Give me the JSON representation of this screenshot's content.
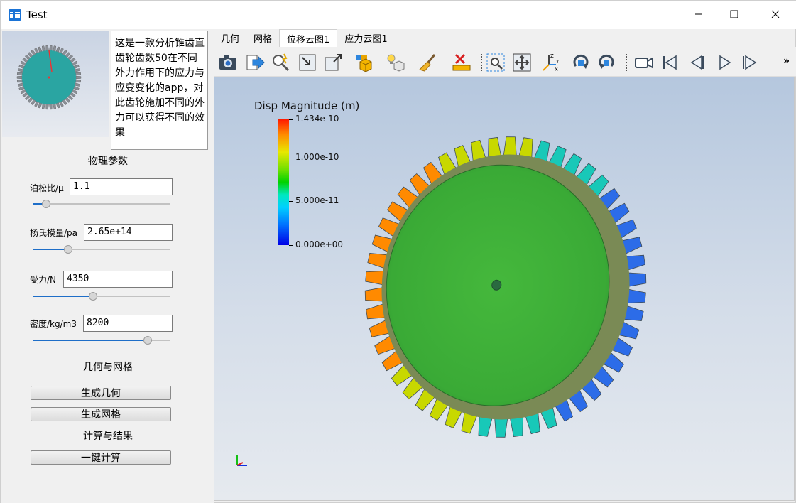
{
  "window": {
    "title": "Test",
    "icon": "app-table-icon",
    "controls": [
      "minimize-icon",
      "maximize-icon",
      "close-icon"
    ]
  },
  "left": {
    "description": "这是一款分析锥齿直齿轮齿数50在不同外力作用下的应力与应变变化的app，对此齿轮施加不同的外力可以获得不同的效果",
    "sections": {
      "physics": "物理参数",
      "geometry": "几何与网格",
      "compute": "计算与结果"
    },
    "params": {
      "poisson": {
        "label": "泊松比/μ",
        "value": "1.1",
        "slider": 0.1
      },
      "youngs": {
        "label": "杨氏模量/pa",
        "value": "2.65e+14",
        "slider": 0.26
      },
      "force": {
        "label": "受力/N",
        "value": "4350",
        "slider": 0.44
      },
      "density": {
        "label": "密度/kg/m3",
        "value": "8200",
        "slider": 0.84
      }
    },
    "buttons": {
      "gen_geometry": "生成几何",
      "gen_mesh": "生成网格",
      "compute": "一键计算"
    }
  },
  "tabs": [
    {
      "label": "几何",
      "active": false
    },
    {
      "label": "网格",
      "active": false
    },
    {
      "label": "位移云图1",
      "active": true
    },
    {
      "label": "应力云图1",
      "active": false
    }
  ],
  "toolbar": {
    "more": "»",
    "icons": [
      "camera-icon",
      "export-icon",
      "zoom-interactive-icon",
      "box-select-icon",
      "box-expand-icon",
      "cube-color-icon",
      "light-cube-icon",
      "brush-icon",
      "ruler-delete-icon",
      "zoom-to-box-icon",
      "fit-view-icon",
      "axes-orientation-icon",
      "rotate-cw-icon",
      "rotate-ccw-icon",
      "video-camera-icon",
      "first-frame-icon",
      "previous-frame-icon",
      "play-icon",
      "last-frame-icon"
    ]
  },
  "viewport": {
    "legend": {
      "title": "Disp Magnitude (m)",
      "labels": [
        "1.434e-10",
        "1.000e-10",
        "5.000e-11",
        "0.000e+00"
      ],
      "values": [
        1.434e-10,
        1e-10,
        5e-11,
        0.0
      ],
      "range": [
        0.0,
        1.434e-10
      ]
    },
    "model": {
      "teeth": 50,
      "face_color": "#3fb23a"
    }
  },
  "colors": {
    "accent": "#1e6ec8",
    "viewport_top": "#b5c7de",
    "viewport_bottom": "#e6eaef"
  }
}
